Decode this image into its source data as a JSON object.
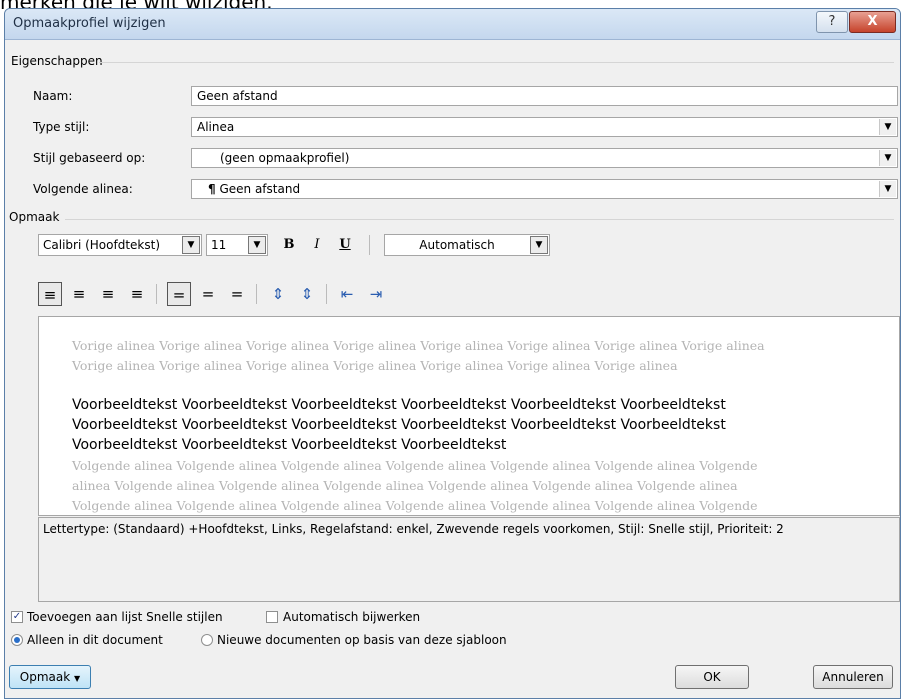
{
  "top_text": "merken die je wilt wijzigen.",
  "window": {
    "title": "Opmaakprofiel wijzigen",
    "help": "?",
    "close": "X"
  },
  "properties": {
    "group_label": "Eigenschappen",
    "name_label": "Naam:",
    "name_value": "Geen afstand",
    "type_label": "Type stijl:",
    "type_value": "Alinea",
    "based_label": "Stijl gebaseerd op:",
    "based_value": "(geen opmaakprofiel)",
    "next_label": "Volgende alinea:",
    "next_value": "Geen afstand",
    "next_mark": "¶"
  },
  "format": {
    "group_label": "Opmaak",
    "font": "Calibri (Hoofdtekst)",
    "size": "11",
    "bold": "B",
    "italic": "I",
    "underline": "U",
    "color": "Automatisch"
  },
  "preview": {
    "previous_lines": [
      "Vorige alinea Vorige alinea Vorige alinea Vorige alinea Vorige alinea Vorige alinea Vorige alinea Vorige alinea",
      "Vorige alinea Vorige alinea Vorige alinea Vorige alinea Vorige alinea Vorige alinea Vorige alinea"
    ],
    "sample_lines": [
      "Voorbeeldtekst Voorbeeldtekst Voorbeeldtekst Voorbeeldtekst Voorbeeldtekst Voorbeeldtekst",
      "Voorbeeldtekst Voorbeeldtekst Voorbeeldtekst Voorbeeldtekst Voorbeeldtekst Voorbeeldtekst",
      "Voorbeeldtekst Voorbeeldtekst Voorbeeldtekst Voorbeeldtekst"
    ],
    "next_lines": [
      "Volgende alinea Volgende alinea Volgende alinea Volgende alinea Volgende alinea Volgende alinea Volgende",
      "alinea Volgende alinea Volgende alinea Volgende alinea Volgende alinea Volgende alinea Volgende alinea",
      "Volgende alinea Volgende alinea Volgende alinea Volgende alinea Volgende alinea Volgende alinea Volgende"
    ]
  },
  "description": "Lettertype: (Standaard) +Hoofdtekst, Links, Regelafstand:  enkel, Zwevende regels voorkomen, Stijl: Snelle stijl, Prioriteit: 2",
  "options": {
    "add_quick_styles": "Toevoegen aan lijst Snelle stijlen",
    "auto_update": "Automatisch bijwerken",
    "only_this_doc": "Alleen in dit document",
    "new_docs": "Nieuwe documenten op basis van deze sjabloon"
  },
  "buttons": {
    "format": "Opmaak",
    "ok": "OK",
    "cancel": "Annuleren"
  }
}
